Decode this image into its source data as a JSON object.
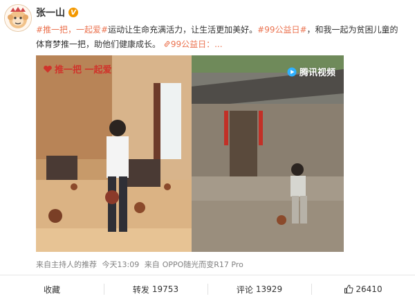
{
  "user": {
    "name": "张一山",
    "verified_badge": "V"
  },
  "post": {
    "hashtag1": "#推一把，一起爱#",
    "text1": "运动让生命充满活力，让生活更加美好。",
    "hashtag2": "#99公益日#",
    "text2": "，和我一起为贫困儿童的体育梦推一把，助他们健康成长。",
    "link_text": "99公益日：...",
    "link_icon": "link-icon"
  },
  "media": {
    "watermark_left": "推一把 一起爱",
    "watermark_right": "腾讯视频"
  },
  "meta": {
    "source_prefix": "来自主持人的推荐",
    "time": "今天13:09",
    "from_label": "来自",
    "device": "OPPO随光而变R17 Pro"
  },
  "actions": {
    "favorite_label": "收藏",
    "repost_label": "转发",
    "repost_count": "19753",
    "comment_label": "评论",
    "comment_count": "13929",
    "like_count": "26410"
  },
  "colors": {
    "accent": "#eb7350",
    "badge": "#f39800",
    "watermark_red": "#d0332b"
  }
}
